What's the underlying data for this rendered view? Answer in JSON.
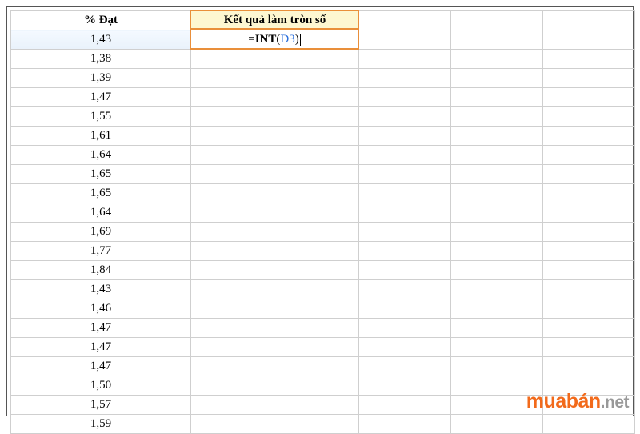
{
  "headers": {
    "colA": "% Đạt",
    "colB": "Kết quả làm tròn số"
  },
  "formula": {
    "eq": "=",
    "fn": "INT",
    "open": "(",
    "ref": "D3",
    "close": ")"
  },
  "values": [
    "1,43",
    "1,38",
    "1,39",
    "1,47",
    "1,55",
    "1,61",
    "1,64",
    "1,65",
    "1,65",
    "1,64",
    "1,69",
    "1,77",
    "1,84",
    "1,43",
    "1,46",
    "1,47",
    "1,47",
    "1,47",
    "1,50",
    "1,57",
    "1,59"
  ],
  "brand": {
    "name": "muabán",
    "tld": ".net"
  },
  "chart_data": {
    "type": "table",
    "columns": [
      "% Đạt",
      "Kết quả làm tròn số"
    ],
    "rows": [
      [
        "1,43",
        "=INT(D3)"
      ],
      [
        "1,38",
        ""
      ],
      [
        "1,39",
        ""
      ],
      [
        "1,47",
        ""
      ],
      [
        "1,55",
        ""
      ],
      [
        "1,61",
        ""
      ],
      [
        "1,64",
        ""
      ],
      [
        "1,65",
        ""
      ],
      [
        "1,65",
        ""
      ],
      [
        "1,64",
        ""
      ],
      [
        "1,69",
        ""
      ],
      [
        "1,77",
        ""
      ],
      [
        "1,84",
        ""
      ],
      [
        "1,43",
        ""
      ],
      [
        "1,46",
        ""
      ],
      [
        "1,47",
        ""
      ],
      [
        "1,47",
        ""
      ],
      [
        "1,47",
        ""
      ],
      [
        "1,50",
        ""
      ],
      [
        "1,57",
        ""
      ],
      [
        "1,59",
        ""
      ]
    ]
  }
}
